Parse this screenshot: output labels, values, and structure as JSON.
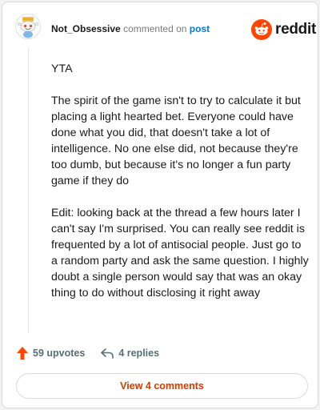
{
  "header": {
    "username": "Not_Obsessive",
    "action_text": "commented on",
    "post_link": "post",
    "brand": "reddit"
  },
  "comment": {
    "paragraphs": [
      "YTA",
      "The spirit of the game isn't to try to calculate it but placing a light hearted bet. Everyone could have done what you did, that doesn't take a lot of intelligence. No one else did, not because they're too dumb, but because it's no longer a fun party game if they do",
      "Edit: looking back at the thread a few hours later I can't say I'm surprised. You can really see reddit is frequented by a lot of antisocial people. Just go to a random party and ask the same question. I highly doubt a single person would say that was an okay thing to do without disclosing it right away"
    ]
  },
  "actions": {
    "upvotes": "59 upvotes",
    "replies": "4 replies"
  },
  "footer": {
    "view_comments": "View 4 comments"
  },
  "colors": {
    "reddit_orange": "#ff4500",
    "upvote_orange": "#ff4500",
    "link_blue": "#0079d3",
    "view_button_text": "#d93a00"
  }
}
